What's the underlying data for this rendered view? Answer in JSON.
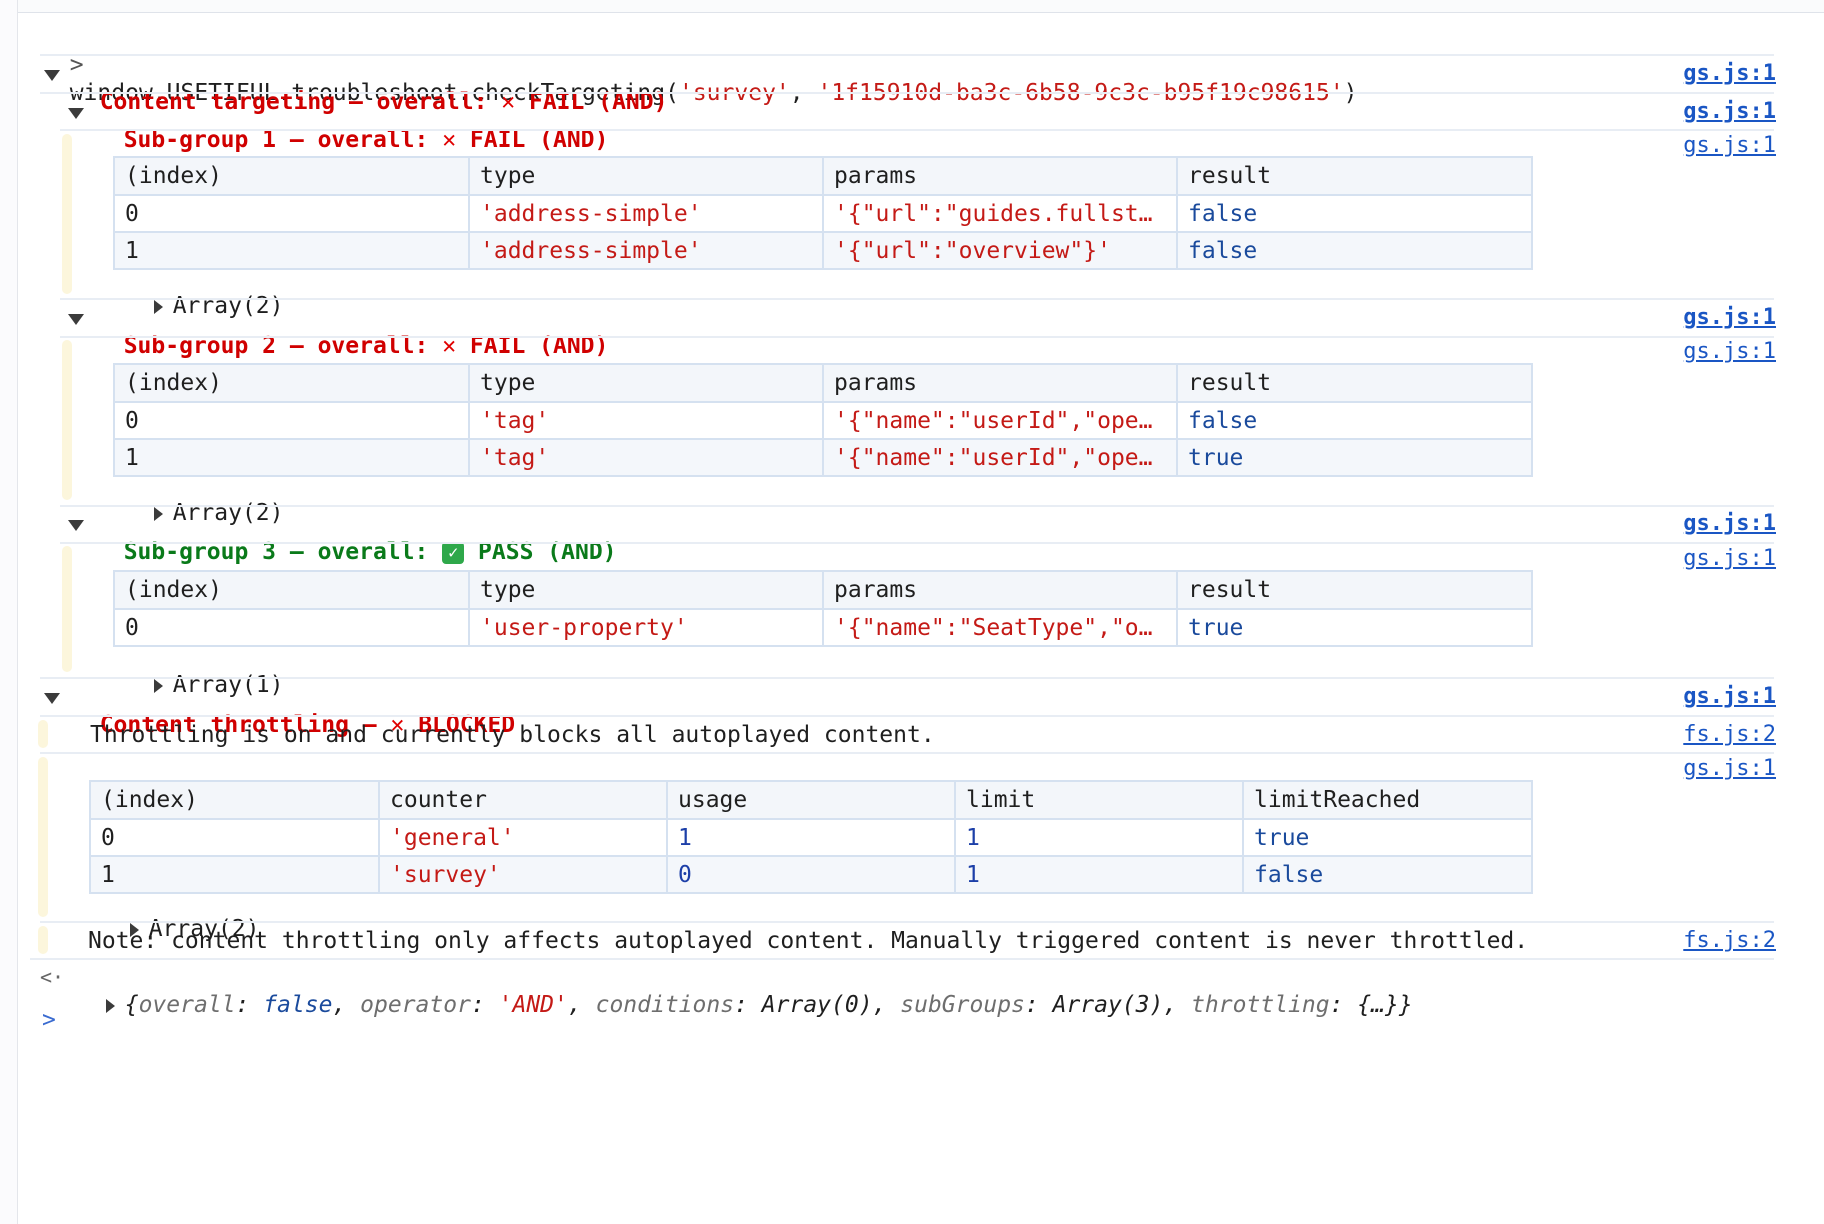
{
  "command": {
    "prompt_glyph": ">",
    "prefix": "window.USETIFUL.troubleshoot.checkTargeting(",
    "arg1": "'survey'",
    "comma": ", ",
    "arg2": "'1f15910d-ba3c-6b58-9c3c-b95f19c98615'",
    "suffix": ")"
  },
  "content_targeting": {
    "prefix": "Content targeting – overall: ",
    "x_glyph": "✕",
    "status": " FAIL (AND)",
    "link": "gs.js:1"
  },
  "subgroups": [
    {
      "prefix": "Sub-group 1 – overall: ",
      "glyph": "✕",
      "status": " FAIL (AND)",
      "link": "gs.js:1",
      "table_link": "gs.js:1",
      "headers": [
        "(index)",
        "type",
        "params",
        "result"
      ],
      "rows": [
        [
          "0",
          "'address-simple'",
          "'{\"url\":\"guides.fullstory.co…",
          "false"
        ],
        [
          "1",
          "'address-simple'",
          "'{\"url\":\"overview\"}'",
          "false"
        ]
      ],
      "array_label": "Array(2)"
    },
    {
      "prefix": "Sub-group 2 – overall: ",
      "glyph": "✕",
      "status": " FAIL (AND)",
      "link": "gs.js:1",
      "table_link": "gs.js:1",
      "headers": [
        "(index)",
        "type",
        "params",
        "result"
      ],
      "rows": [
        [
          "0",
          "'tag'",
          "'{\"name\":\"userId\",\"operator\"…",
          "false"
        ],
        [
          "1",
          "'tag'",
          "'{\"name\":\"userId\",\"operator\"…",
          "true"
        ]
      ],
      "array_label": "Array(2)"
    },
    {
      "prefix": "Sub-group 3 – overall: ",
      "glyph": "✓",
      "status": " PASS (AND)",
      "link": "gs.js:1",
      "table_link": "gs.js:1",
      "headers": [
        "(index)",
        "type",
        "params",
        "result"
      ],
      "rows": [
        [
          "0",
          "'user-property'",
          "'{\"name\":\"SeatType\",\"operato…",
          "true"
        ]
      ],
      "array_label": "Array(1)"
    }
  ],
  "throttling": {
    "prefix": "Content throttling – ",
    "x_glyph": "✕",
    "status": " BLOCKED",
    "link": "gs.js:1",
    "message": "Throttling is on and currently blocks all autoplayed content.",
    "message_link": "fs.js:2",
    "table_link": "gs.js:1",
    "headers": [
      "(index)",
      "counter",
      "usage",
      "limit",
      "limitReached"
    ],
    "rows": [
      [
        "0",
        "'general'",
        "1",
        "1",
        "true"
      ],
      [
        "1",
        "'survey'",
        "0",
        "1",
        "false"
      ]
    ],
    "array_label": "Array(2)",
    "note": "Note: content throttling only affects autoplayed content. Manually triggered content is never throttled.",
    "note_link": "fs.js:2"
  },
  "result": {
    "return_glyph": "<·",
    "open": "{",
    "k1": "overall",
    "v1": "false",
    "k2": "operator",
    "v2": "'AND'",
    "k3": "conditions",
    "v3": "Array(0)",
    "k4": "subGroups",
    "v4": "Array(3)",
    "k5": "throttling",
    "v5": "{…}",
    "close": "}"
  },
  "next_prompt": ">"
}
